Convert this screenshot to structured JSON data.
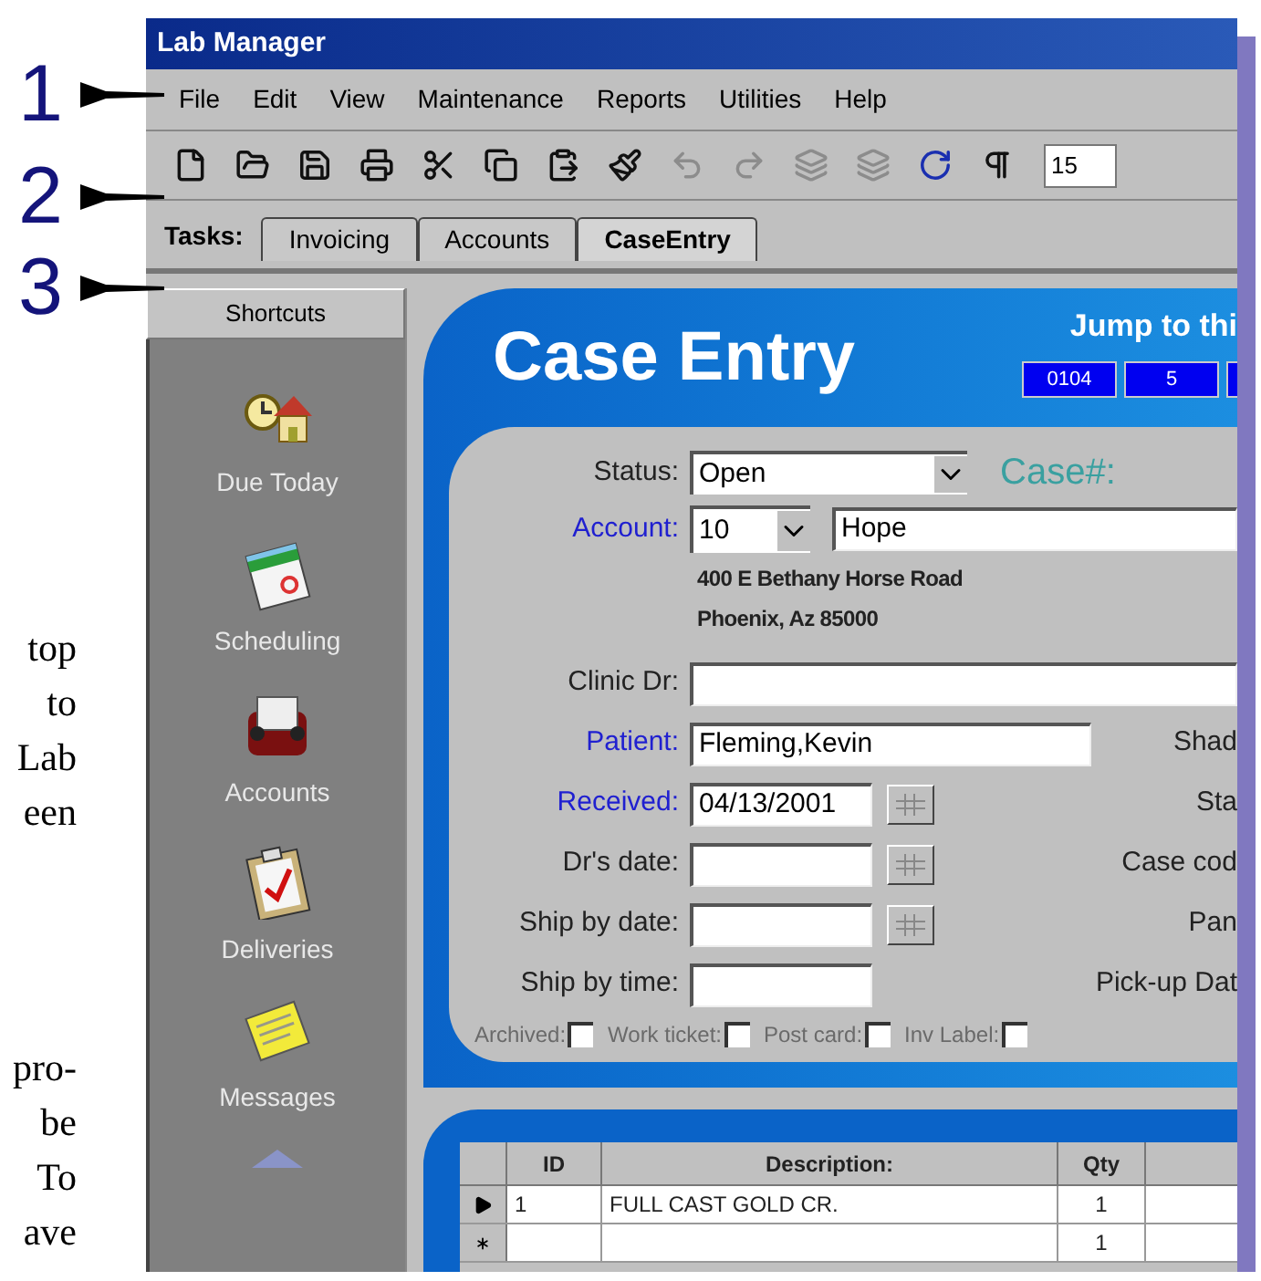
{
  "margin": {
    "callouts": [
      "1",
      "2",
      "3"
    ],
    "fragment_top": [
      "top",
      "to",
      "Lab",
      "een"
    ],
    "fragment_bottom": [
      "pro-",
      "be",
      "To",
      "ave"
    ]
  },
  "window": {
    "title": "Lab Manager"
  },
  "menu": [
    "File",
    "Edit",
    "View",
    "Maintenance",
    "Reports",
    "Utilities",
    "Help"
  ],
  "toolbar": {
    "buttons": [
      {
        "kind": "new",
        "disabled": false
      },
      {
        "kind": "open",
        "disabled": false
      },
      {
        "kind": "save",
        "disabled": false
      },
      {
        "kind": "print",
        "disabled": false
      },
      {
        "kind": "cut",
        "disabled": false
      },
      {
        "kind": "copy",
        "disabled": false
      },
      {
        "kind": "paste",
        "disabled": false
      },
      {
        "kind": "brush",
        "disabled": false
      },
      {
        "kind": "undo",
        "disabled": true
      },
      {
        "kind": "redo",
        "disabled": true
      },
      {
        "kind": "layers",
        "disabled": true
      },
      {
        "kind": "layers",
        "disabled": true
      },
      {
        "kind": "refresh",
        "disabled": false
      },
      {
        "kind": "pilcrow",
        "disabled": false
      }
    ],
    "zoom_value": "15"
  },
  "tasks": {
    "label": "Tasks:",
    "tabs": [
      {
        "label": "Invoicing",
        "selected": false
      },
      {
        "label": "Accounts",
        "selected": false
      },
      {
        "label": "CaseEntry",
        "selected": true
      }
    ]
  },
  "shortcuts": {
    "title": "Shortcuts",
    "items": [
      {
        "kind": "due",
        "label": "Due Today"
      },
      {
        "kind": "schedule",
        "label": "Scheduling"
      },
      {
        "kind": "accounts",
        "label": "Accounts"
      },
      {
        "kind": "deliveries",
        "label": "Deliveries"
      },
      {
        "kind": "messages",
        "label": "Messages"
      },
      {
        "kind": "more"
      }
    ]
  },
  "case_entry": {
    "title": "Case Entry",
    "jump_label": "Jump to thi",
    "jump_fields": [
      "0104",
      "5"
    ],
    "status": {
      "label": "Status:",
      "value": "Open"
    },
    "case_number_label": "Case#:",
    "account": {
      "label": "Account:",
      "link": true,
      "number": "10",
      "name": "Hope"
    },
    "address": [
      "400 E Bethany Horse Road",
      "Phoenix, Az 85000"
    ],
    "fields": [
      {
        "kind": "wide",
        "label": "Clinic Dr:",
        "link": false
      },
      {
        "kind": "text",
        "label": "Patient:",
        "link": true,
        "value": "Fleming,Kevin",
        "side_label": "Shad"
      },
      {
        "kind": "date",
        "label": "Received:",
        "link": true,
        "value": "04/13/2001",
        "side_label": "Sta"
      },
      {
        "kind": "date",
        "label": "Dr's date:",
        "link": false,
        "side_label": "Case cod"
      },
      {
        "kind": "date",
        "label": "Ship by date:",
        "link": false,
        "side_label": "Pan"
      },
      {
        "kind": "short",
        "label": "Ship by time:",
        "link": false,
        "side_label": "Pick-up Dat"
      }
    ],
    "checkboxes": [
      {
        "label": "Archived:",
        "checked": false,
        "disabled": true
      },
      {
        "label": "Work ticket:",
        "checked": false,
        "disabled": true
      },
      {
        "label": "Post card:",
        "checked": false,
        "disabled": true
      },
      {
        "label": "Inv Label:",
        "checked": false,
        "disabled": true
      }
    ],
    "table": {
      "columns": [
        "ID",
        "Description:",
        "Qty"
      ],
      "rows": [
        {
          "kind": "current",
          "id": "1",
          "description": "FULL CAST GOLD CR.",
          "qty": "1"
        },
        {
          "kind": "new",
          "qty": "1"
        }
      ]
    }
  }
}
